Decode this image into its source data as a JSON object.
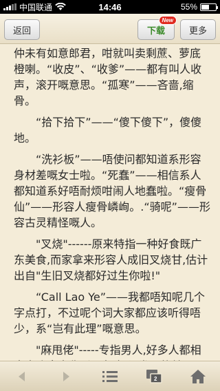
{
  "status_bar": {
    "carrier": "中国联通",
    "time": "14:46",
    "battery": "55%",
    "battery_level": 0.55
  },
  "top_bar": {
    "back_label": "返回",
    "download_label": "下载",
    "new_badge": "New",
    "more_label": "更多"
  },
  "content": {
    "paragraphs": [
      "仲未有如意郎君，咁就叫卖剩蔗、萝底橙喇。“收皮”、“收爹”——都有叫人收声，滚开嘅意思。“孤寒”——吝啬,缩骨。",
      "“拾下拾下”——“傻下傻下”，傻傻地。",
      "“洗衫板”——唔使问都知道系形容身材差嘅女士啦。“死蠢”——相信系人都知道系好唔耐烦咁闹人地蠢啦。“瘦骨仙”——形容人瘦骨嶙峋。.“骑呢”——形容古灵精怪嘅人。",
      "\"叉烧\"------原来特指一种好食既广东美食,而家拿来形容人成旧叉烧甘,估计出自\"生旧叉烧都好过生你啦!\"",
      "“Call Lao Ye”——我都唔知呢几个字点打，不过呢个词大家都应该听得唔少，系“岂有此理”嘅意思。",
      "\"麻甩佬\"-----专指男人,好多人都相当喜欢拿来称呼朋友,好似发哥的某"
    ]
  },
  "bottom_bar": {
    "tab_count": "2",
    "icons": [
      "back-arrow-icon",
      "forward-arrow-icon",
      "list-icon",
      "tabs-icon",
      "home-icon"
    ]
  }
}
